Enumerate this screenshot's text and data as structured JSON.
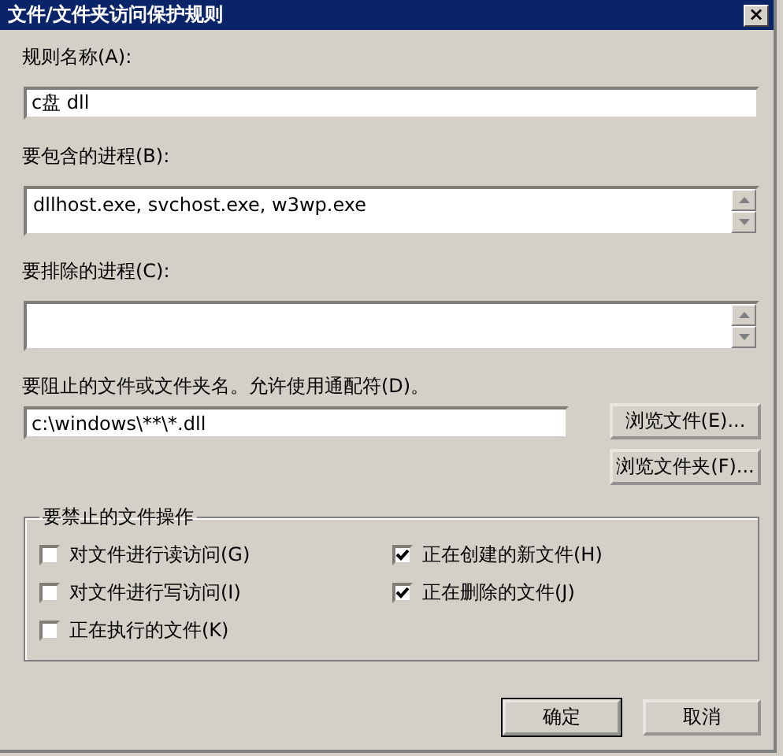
{
  "window": {
    "title": "文件/文件夹访问保护规则",
    "close": "×"
  },
  "rule_name": {
    "label": "规则名称(A):",
    "value": "c盘 dll"
  },
  "include_processes": {
    "label": "要包含的进程(B):",
    "value": "dllhost.exe, svchost.exe, w3wp.exe"
  },
  "exclude_processes": {
    "label": "要排除的进程(C):"
  },
  "blocked_path": {
    "label": "要阻止的文件或文件夹名。允许使用通配符(D)。",
    "value": "c:\\windows\\**\\*.dll"
  },
  "browse_buttons": [
    "浏览文件(E)...",
    "浏览文件夹(F)..."
  ],
  "operations": {
    "title": "要禁止的文件操作",
    "items": [
      {
        "label": "对文件进行读访问(G)",
        "checked": false
      },
      {
        "label": "正在创建的新文件(H)",
        "checked": true
      },
      {
        "label": "对文件进行写访问(I)",
        "checked": false
      },
      {
        "label": "正在删除的文件(J)",
        "checked": true
      },
      {
        "label": "正在执行的文件(K)",
        "checked": false
      }
    ]
  },
  "buttons": [
    "确定",
    "取消"
  ]
}
